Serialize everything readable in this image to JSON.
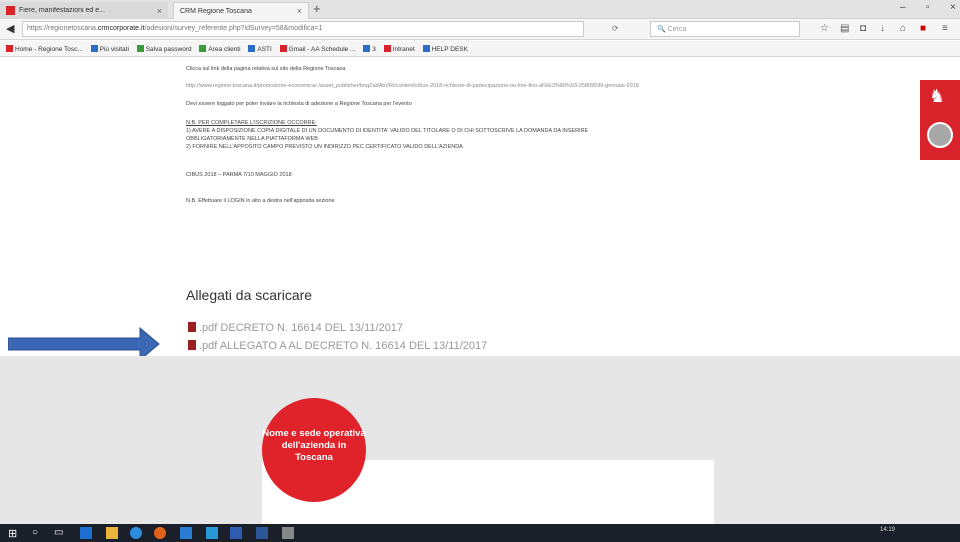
{
  "browser": {
    "tabs": [
      {
        "label": "Fiere, manifestazioni ed e..."
      },
      {
        "label": "CRM Regione Toscana"
      }
    ],
    "new_tab": "+",
    "close": "×",
    "win_min": "–",
    "win_max": "▫",
    "win_close": "×",
    "back": "◀",
    "url_prefix": "https://regionetoscana.",
    "url_domain": "crmcorporate.it",
    "url_suffix": "/adesioni/survey_referente.php?idSurvey=58&modifica=1",
    "search_placeholder": "Cerca",
    "bookmarks": [
      {
        "label": "Home - Regione Tosc...",
        "icon": "regione-icon"
      },
      {
        "label": "Più visitati",
        "icon": "star-icon"
      },
      {
        "label": "Salva password",
        "icon": "key-icon"
      },
      {
        "label": "Area clienti",
        "icon": "user-icon"
      },
      {
        "label": "ASTI",
        "icon": "folder-icon"
      },
      {
        "label": "Gmail - AA Schedule ...",
        "icon": "gmail-icon"
      },
      {
        "label": "3",
        "icon": "wind-icon"
      },
      {
        "label": "Intranet",
        "icon": "rt-icon"
      },
      {
        "label": "HELP DESK",
        "icon": "helpdesk-icon"
      }
    ]
  },
  "content": {
    "line1": "Clicca sul link della pagina relativa sul sito della Regione Toscana",
    "link": "http://www.regione.toscana.it/promozione-economica/-/asset_publisher/bnqZadAbVRi/content/cibus-2018-richieste-di-partecipazione-on-line-fino-al%E2%80%93-25809599-gennaio-2018",
    "line3": "Devi essere loggato per poter inviare la richiesta di adesione a Regione Toscana per l'evento",
    "nb_title": "N.B. PER COMPLETARE L'ISCRIZIONE OCCORRE:",
    "nb1": "1) AVERE A DISPOSIZIONE COPIA DIGITALE DI UN DOCUMENTO DI IDENTITA' VALIDO DEL TITOLARE O DI CHI SOTTOSCRIVE LA DOMANDA DA INSERIRE",
    "nb1b": "OBBLIGATORIAMENTE NELLA PIATTAFORMA WEB",
    "nb2": "2) FORNIRE NELL'APPOSITO CAMPO PREVISTO UN INDIRIZZO PEC CERTIFICATO VALIDO DELL'AZIENDA",
    "event": "CIBUS 2018 – PARMA 7/10 MAGGIO 2018",
    "login_note": "N.B. Effettuare il LOGIN in alto a destra nell'apposita sezione",
    "attachments_title": "Allegati da scaricare",
    "attachments": [
      {
        "type": ".pdf",
        "name": "DECRETO N. 16614 DEL 13/11/2017"
      },
      {
        "type": ".pdf",
        "name": "ALLEGATO A AL DECRETO N. 16614 DEL 13/11/2017"
      }
    ]
  },
  "form": {
    "step_label": "Nome e sede operativa dell'azienda in Toscana"
  },
  "taskbar": {
    "time": "14:19"
  },
  "colors": {
    "accent_red": "#e0232a",
    "arrow_blue": "#3b67b5"
  }
}
